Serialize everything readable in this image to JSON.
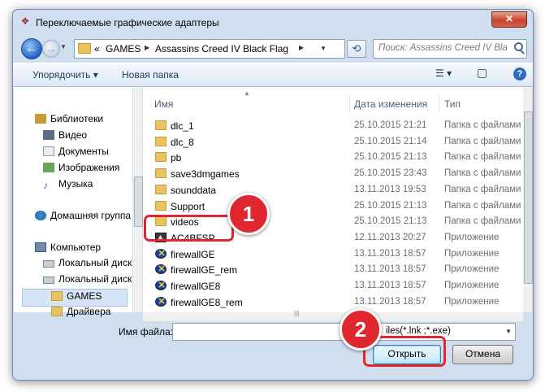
{
  "window": {
    "title": "Переключаемые графические адаптеры",
    "close_label": "✕"
  },
  "nav": {
    "back_icon": "←",
    "forward_icon": "→",
    "breadcrumb": [
      "GAMES",
      "Assassins Creed IV Black Flag"
    ],
    "breadcrumb_prefix": "«",
    "refresh_icon": "⟲",
    "search_placeholder": "Поиск: Assassins Creed IV Bla..."
  },
  "toolbar": {
    "organize_label": "Упорядочить ▾",
    "new_folder_label": "Новая папка",
    "views_icon": "☰ ▾",
    "pane_icon": "▢",
    "help_label": "?"
  },
  "sidebar": {
    "items": [
      {
        "label": "Библиотеки",
        "icon": "library-icon"
      },
      {
        "label": "Видео",
        "icon": "video-icon"
      },
      {
        "label": "Документы",
        "icon": "documents-icon"
      },
      {
        "label": "Изображения",
        "icon": "images-icon"
      },
      {
        "label": "Музыка",
        "icon": "music-icon"
      },
      {
        "label": "Домашняя группа",
        "icon": "homegroup-icon"
      },
      {
        "label": "Компьютер",
        "icon": "computer-icon"
      },
      {
        "label": "Локальный диск",
        "icon": "disk-icon"
      },
      {
        "label": "Локальный диск",
        "icon": "disk-icon"
      },
      {
        "label": "GAMES",
        "icon": "folder-icon"
      },
      {
        "label": "Драйвера",
        "icon": "folder-icon"
      }
    ]
  },
  "columns": {
    "name": "Имя",
    "date": "Дата изменения",
    "type": "Тип"
  },
  "files": [
    {
      "name": "dlc_1",
      "date": "25.10.2015 21:21",
      "type": "Папка с файлами",
      "kind": "folder"
    },
    {
      "name": "dlc_8",
      "date": "25.10.2015 21:14",
      "type": "Папка с файлами",
      "kind": "folder"
    },
    {
      "name": "pb",
      "date": "25.10.2015 21:13",
      "type": "Папка с файлами",
      "kind": "folder"
    },
    {
      "name": "save3dmgames",
      "date": "25.10.2015 23:43",
      "type": "Папка с файлами",
      "kind": "folder"
    },
    {
      "name": "sounddata",
      "date": "13.11.2013 19:53",
      "type": "Папка с файлами",
      "kind": "folder"
    },
    {
      "name": "Support",
      "date": "25.10.2015 21:13",
      "type": "Папка с файлами",
      "kind": "folder"
    },
    {
      "name": "videos",
      "date": "25.10.2015 21:13",
      "type": "Папка с файлами",
      "kind": "folder"
    },
    {
      "name": "AC4BFSP",
      "date": "12.11.2013 20:27",
      "type": "Приложение",
      "kind": "ac"
    },
    {
      "name": "firewallGE",
      "date": "13.11.2013 18:57",
      "type": "Приложение",
      "kind": "x"
    },
    {
      "name": "firewallGE_rem",
      "date": "13.11.2013 18:57",
      "type": "Приложение",
      "kind": "x"
    },
    {
      "name": "firewallGE8",
      "date": "13.11.2013 18:57",
      "type": "Приложение",
      "kind": "x"
    },
    {
      "name": "firewallGE8_rem",
      "date": "13.11.2013 18:57",
      "type": "Приложение",
      "kind": "x"
    }
  ],
  "bottom": {
    "filename_label": "Имя файла:",
    "filename_value": "",
    "filter_value": "iles(*.lnk ;*.exe)",
    "open_label": "Открыть",
    "cancel_label": "Отмена"
  },
  "annotations": {
    "step1": "1",
    "step2": "2",
    "color": "#e0262e"
  }
}
